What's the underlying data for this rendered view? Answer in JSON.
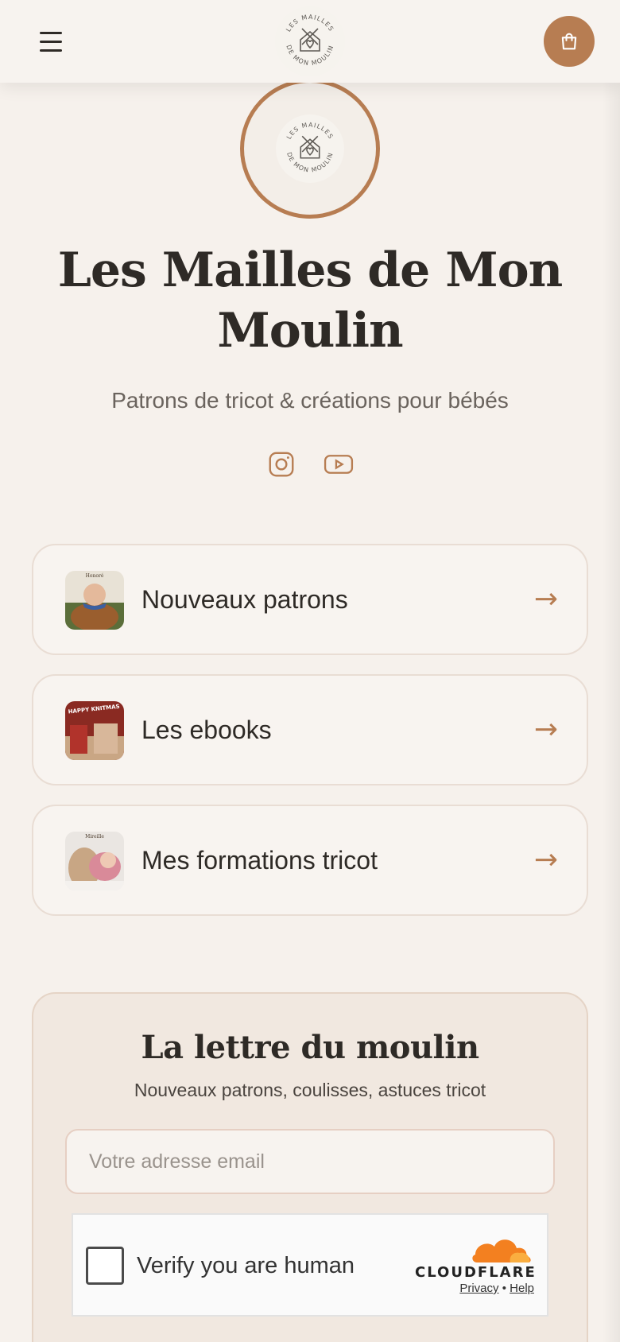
{
  "brand": {
    "name": "Les Mailles de Mon Moulin",
    "tagline": "Patrons de tricot & créations pour bébés",
    "logo_text_top": "LES MAILLES",
    "logo_text_bottom": "DE MON MOULIN",
    "accent_color": "#b77d52",
    "background_color": "#f6f1ec"
  },
  "header": {
    "menu_icon": "hamburger-icon",
    "cart_icon": "shopping-bag-icon"
  },
  "socials": [
    {
      "name": "Instagram",
      "icon": "instagram-icon"
    },
    {
      "name": "YouTube",
      "icon": "youtube-icon"
    }
  ],
  "links": [
    {
      "label": "Nouveaux patrons",
      "arrow": "→",
      "thumb_caption": "Honoré"
    },
    {
      "label": "Les ebooks",
      "arrow": "→",
      "thumb_caption": "HAPPY KNITMAS"
    },
    {
      "label": "Mes formations tricot",
      "arrow": "→",
      "thumb_caption": "Mireille"
    }
  ],
  "newsletter": {
    "title": "La lettre du moulin",
    "subtitle": "Nouveaux patrons, coulisses, astuces tricot",
    "email_placeholder": "Votre adresse email"
  },
  "captcha": {
    "label": "Verify you are human",
    "provider": "CLOUDFLARE",
    "privacy": "Privacy",
    "separator": "•",
    "help": "Help"
  }
}
